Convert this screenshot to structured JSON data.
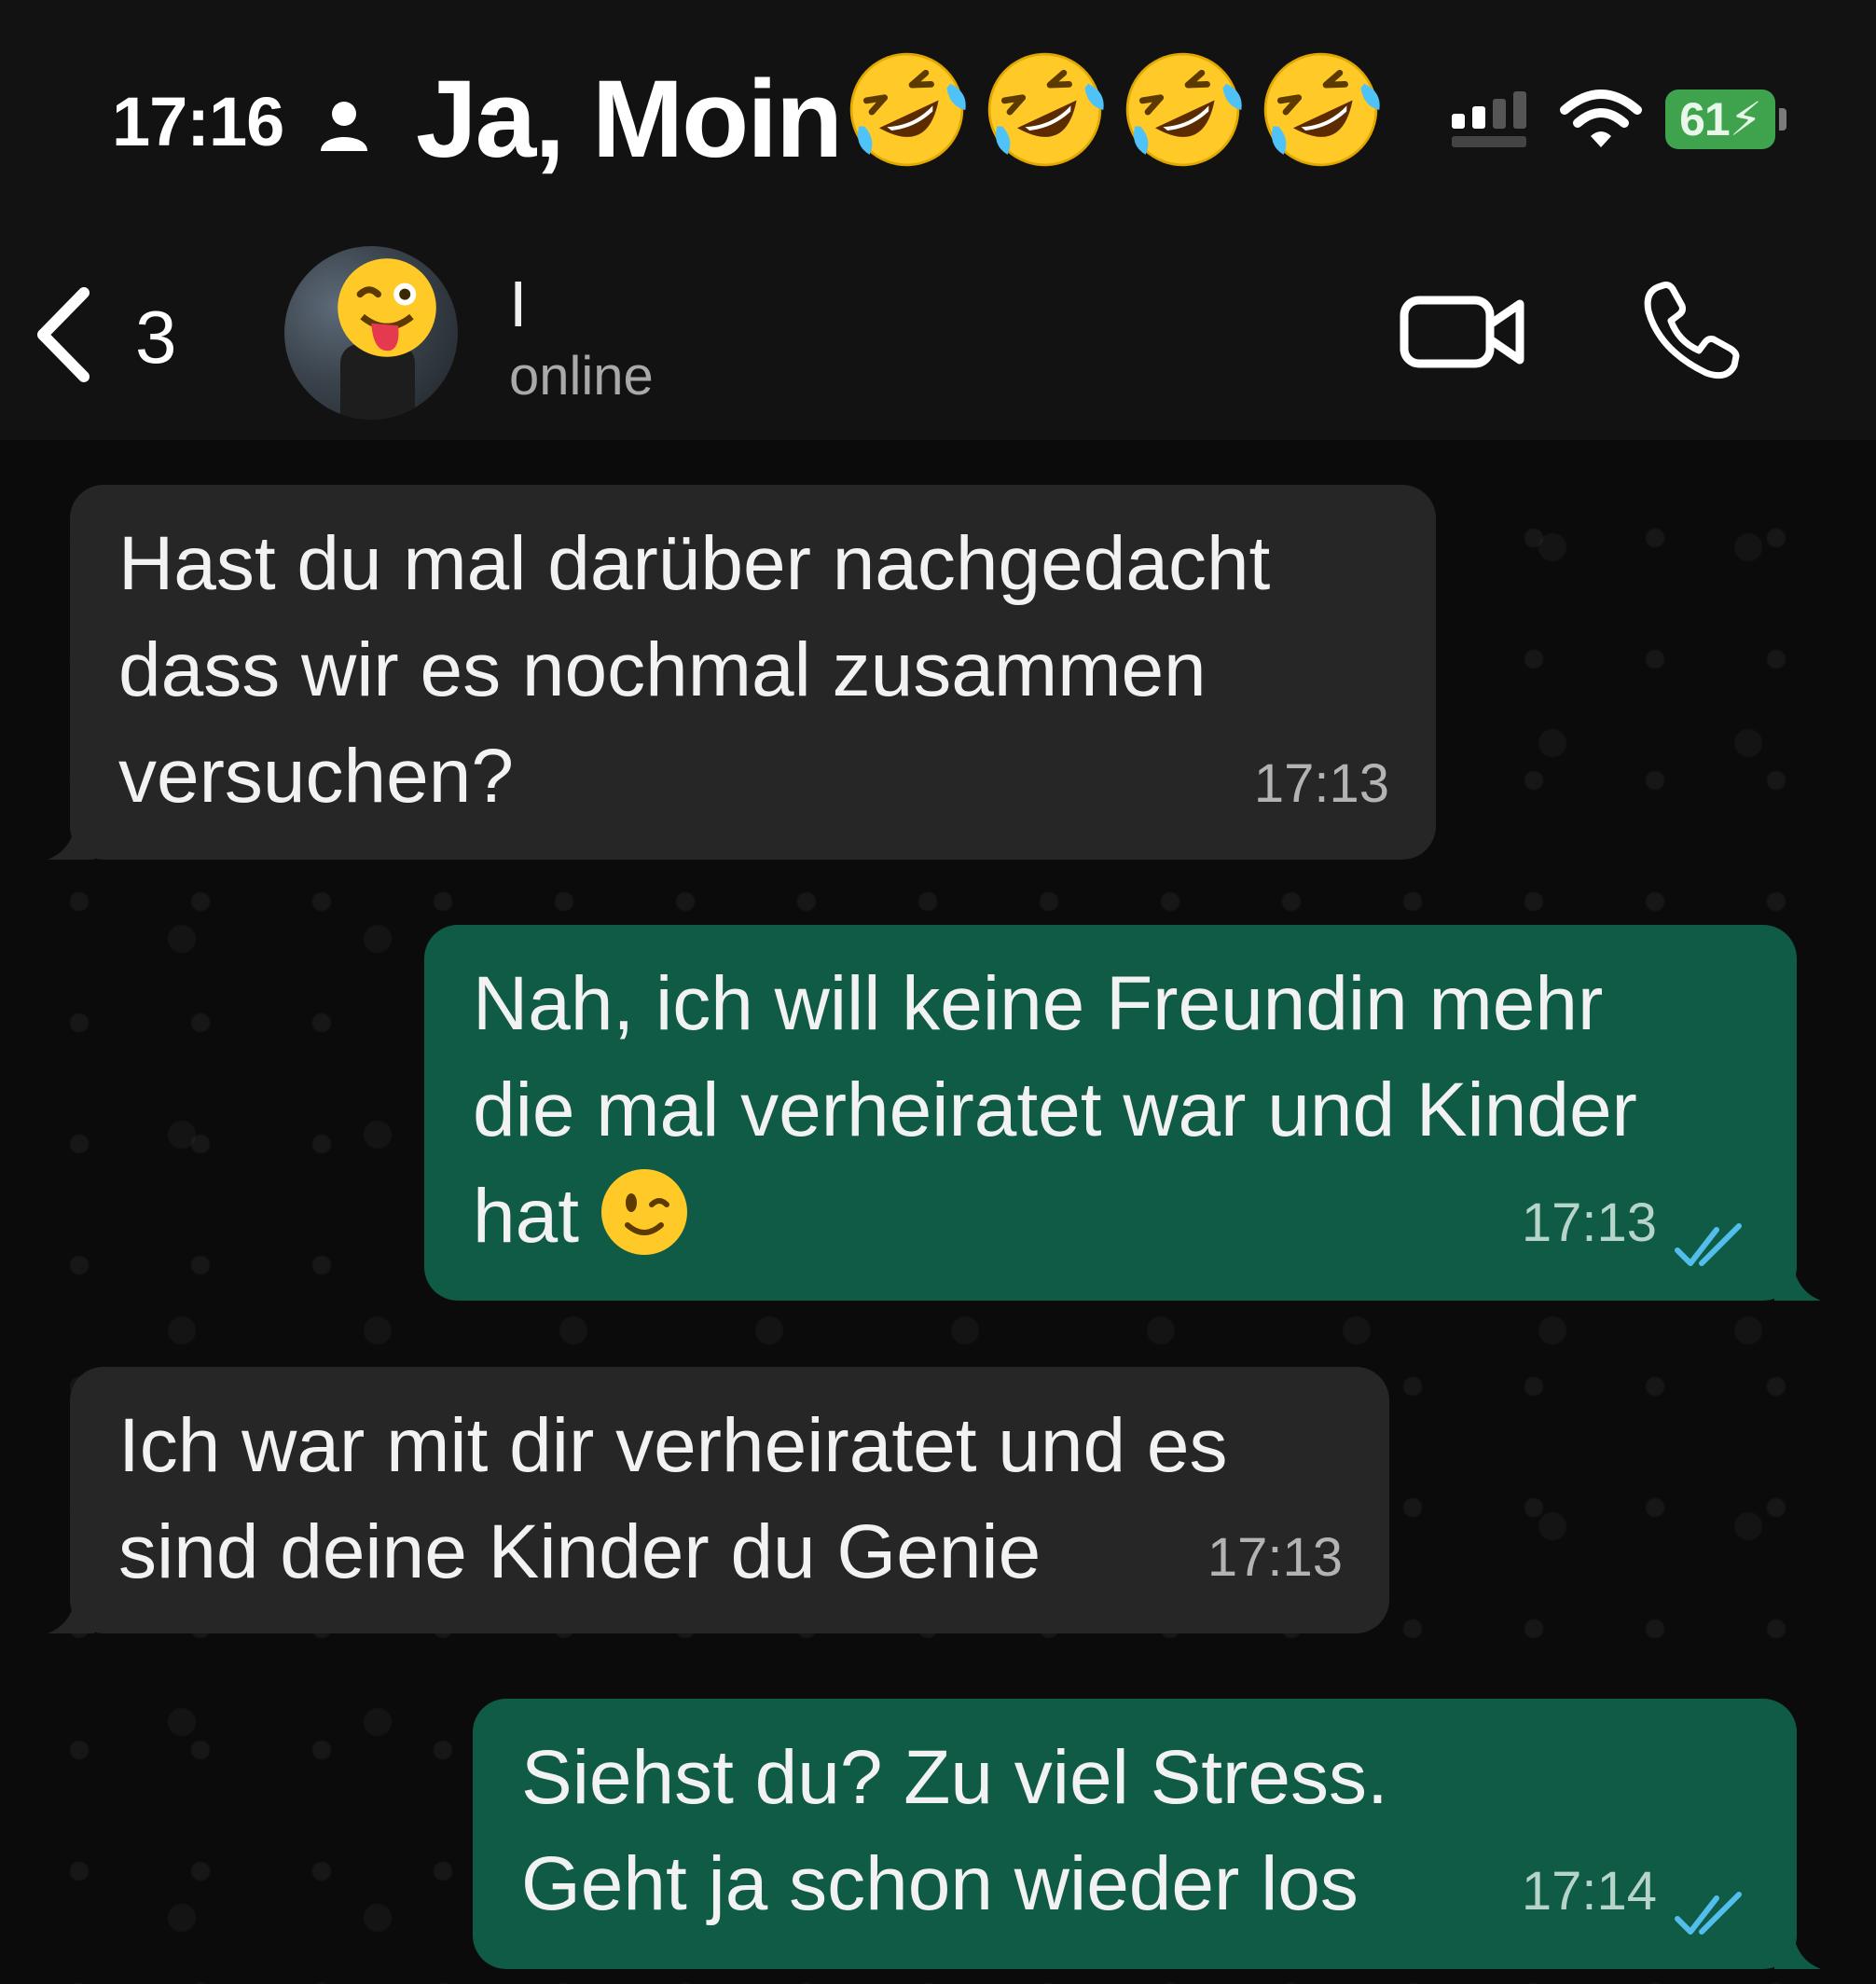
{
  "status_bar": {
    "time": "17:16",
    "banner_title": "Ja, Moin",
    "banner_emojis": [
      "rolling-on-floor-laughing",
      "rolling-on-floor-laughing",
      "rolling-on-floor-laughing",
      "rolling-on-floor-laughing"
    ],
    "battery": "61"
  },
  "header": {
    "back_count": "3",
    "contact_name": "I",
    "contact_status": "online"
  },
  "messages": [
    {
      "direction": "incoming",
      "lines": [
        "Hast du mal darüber nachgedacht",
        "dass wir es nochmal zusammen",
        "versuchen?"
      ],
      "time": "17:13"
    },
    {
      "direction": "outgoing",
      "lines": [
        "Nah, ich will keine Freundin mehr",
        "die mal verheiratet war und Kinder",
        "hat"
      ],
      "emoji": "winking-face",
      "time": "17:13",
      "read": true
    },
    {
      "direction": "incoming",
      "lines": [
        "Ich war mit dir verheiratet und es",
        "sind deine Kinder du Genie"
      ],
      "time": "17:13"
    },
    {
      "direction": "outgoing",
      "lines": [
        "Siehst du? Zu viel Stress.",
        "Geht ja schon wieder los"
      ],
      "time": "17:14",
      "read": true
    }
  ],
  "colors": {
    "incoming_bubble": "#262626",
    "outgoing_bubble": "#0f5b45",
    "battery": "#3fa34d",
    "read_ticks": "#53bdeb"
  }
}
